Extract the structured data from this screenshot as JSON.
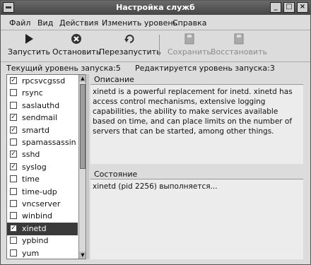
{
  "window": {
    "title": "Настройка служб"
  },
  "menu": [
    {
      "label": "Файл"
    },
    {
      "label": "Вид"
    },
    {
      "label": "Действия"
    },
    {
      "label": "Изменить уровень"
    },
    {
      "label": "Справка"
    }
  ],
  "toolbar": {
    "start_label": "Запустить",
    "stop_label": "Остановить",
    "restart_label": "Перезапустить",
    "save_label": "Сохранить",
    "revert_label": "Восстановить"
  },
  "status": {
    "current_runlevel": "Текущий уровень запуска:5",
    "editing_runlevel": "Редактируется уровень запуска:3"
  },
  "services": [
    {
      "name": "rpcsvcgssd",
      "checked": true
    },
    {
      "name": "rsync",
      "checked": false
    },
    {
      "name": "saslauthd",
      "checked": false
    },
    {
      "name": "sendmail",
      "checked": true
    },
    {
      "name": "smartd",
      "checked": true
    },
    {
      "name": "spamassassin",
      "checked": false
    },
    {
      "name": "sshd",
      "checked": true
    },
    {
      "name": "syslog",
      "checked": true
    },
    {
      "name": "time",
      "checked": false
    },
    {
      "name": "time-udp",
      "checked": false
    },
    {
      "name": "vncserver",
      "checked": false
    },
    {
      "name": "winbind",
      "checked": false
    },
    {
      "name": "xinetd",
      "checked": true,
      "selected": true
    },
    {
      "name": "ypbind",
      "checked": false
    },
    {
      "name": "yum",
      "checked": false
    }
  ],
  "description": {
    "title": "Описание",
    "text": "xinetd is a powerful replacement for inetd. xinetd has access control mechanisms, extensive logging capabilities, the ability to make services available based on time, and can place limits on the number of servers that can be started, among other things."
  },
  "state": {
    "title": "Состояние",
    "text": "xinetd (pid 2256) выполняется..."
  },
  "icons": {
    "start": "play-icon",
    "stop": "stop-icon",
    "restart": "restart-icon",
    "save": "save-icon",
    "revert": "revert-icon"
  }
}
